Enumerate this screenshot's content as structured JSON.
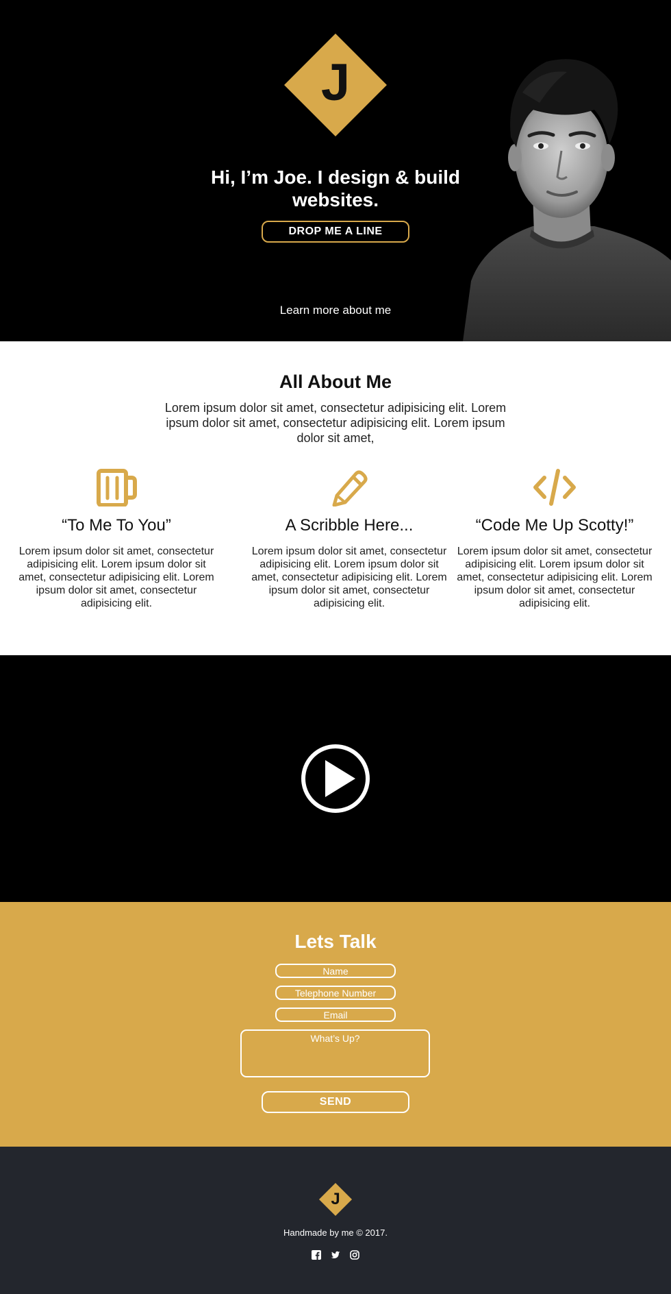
{
  "brand": {
    "logo_letter": "J",
    "accent_color": "#d8a94b"
  },
  "hero": {
    "title": "Hi, I’m Joe. I design & build websites.",
    "cta_label": "DROP ME A LINE",
    "learn_more": "Learn more about me"
  },
  "about": {
    "title": "All About Me",
    "intro": "Lorem ipsum dolor sit amet, consectetur adipisicing elit. Lorem ipsum dolor sit amet, consectetur adipisicing elit. Lorem ipsum dolor sit amet,",
    "features": [
      {
        "icon": "beer-mug-icon",
        "title": "“To Me To You”",
        "text": "Lorem ipsum dolor sit amet, con­sectetur adipisicing elit. Lorem ipsum dolor sit amet, consectetur adipisicing elit. Lorem ipsum dolor sit amet, consectetur adipisicing elit."
      },
      {
        "icon": "pencil-icon",
        "title": "A Scribble Here...",
        "text": "Lorem ipsum dolor sit amet, con­sectetur adipisicing elit. Lorem ipsum dolor sit amet, consectetur adipisicing elit. Lorem ipsum dolor sit amet, consectetur adipisicing elit."
      },
      {
        "icon": "code-icon",
        "title": "“Code Me Up Scotty!”",
        "text": "Lorem ipsum dolor sit amet, con­sectetur adipisicing elit. Lorem ipsum dolor sit amet, consectetur adipisicing elit. Lorem ipsum dolor sit amet, consectetur adipisicing elit."
      }
    ]
  },
  "video": {
    "icon": "play-icon"
  },
  "contact": {
    "title": "Lets Talk",
    "name_placeholder": "Name",
    "phone_placeholder": "Telephone Number",
    "email_placeholder": "Email",
    "message_placeholder": "What’s Up?",
    "send_label": "SEND"
  },
  "footer": {
    "logo_letter": "J",
    "copyright": "Handmade by me © 2017.",
    "socials": [
      "facebook-icon",
      "twitter-icon",
      "instagram-icon"
    ]
  }
}
